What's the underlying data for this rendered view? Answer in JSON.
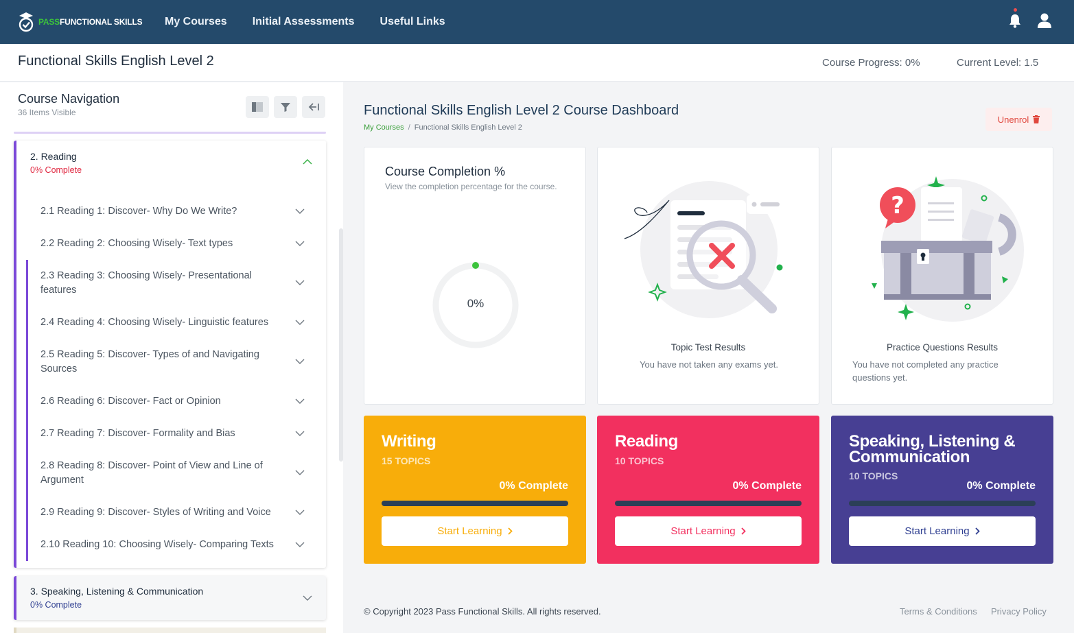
{
  "brand": {
    "pass": "PASS",
    "rest": "FUNCTIONAL SKILLS"
  },
  "nav": {
    "links": [
      "My Courses",
      "Initial Assessments",
      "Useful Links"
    ]
  },
  "course": {
    "title": "Functional Skills English Level 2",
    "progress_label": "Course Progress:",
    "progress_value": "0%",
    "level_label": "Current Level:",
    "level_value": "1.5"
  },
  "sidebar": {
    "title": "Course Navigation",
    "subtitle": "36 Items Visible",
    "sections": [
      {
        "title": "2. Reading",
        "complete": "0% Complete",
        "items": [
          "2.1 Reading 1: Discover- Why Do We Write?",
          "2.2 Reading 2: Choosing Wisely- Text types",
          "2.3 Reading 3: Choosing Wisely- Presentational features",
          "2.4 Reading 4: Choosing Wisely- Linguistic features",
          "2.5 Reading 5: Discover- Types of and Navigating Sources",
          "2.6 Reading 6: Discover- Fact or Opinion",
          "2.7 Reading 7: Discover- Formality and Bias",
          "2.8 Reading 8: Discover- Point of View and Line of Argument",
          "2.9 Reading 9: Discover- Styles of Writing and Voice",
          "2.10 Reading 10: Choosing Wisely- Comparing Texts"
        ]
      },
      {
        "title": "3. Speaking, Listening & Communication",
        "complete": "0% Complete"
      }
    ]
  },
  "dashboard": {
    "title": "Functional Skills English Level 2 Course Dashboard",
    "breadcrumb": [
      "My Courses",
      "Functional Skills English Level 2"
    ],
    "unenrol": "Unenrol",
    "completion": {
      "title": "Course Completion %",
      "subtitle": "View the completion percentage for the course.",
      "value": "0%",
      "fraction": 0
    },
    "topic_tests": {
      "label": "Topic Test Results",
      "text": "You have not taken any exams yet."
    },
    "practice": {
      "label": "Practice Questions Results",
      "text": "You have not completed any practice questions yet."
    },
    "subjects": [
      {
        "name": "Writing",
        "topics": "15 TOPICS",
        "complete": "0% Complete",
        "progress": 0,
        "button": "Start Learning",
        "color": "#f8ad0a"
      },
      {
        "name": "Reading",
        "topics": "10 TOPICS",
        "complete": "0% Complete",
        "progress": 0,
        "button": "Start Learning",
        "color": "#f2305f"
      },
      {
        "name": "Speaking, Listening & Communication",
        "topics": "10 TOPICS",
        "complete": "0% Complete",
        "progress": 0,
        "button": "Start Learning",
        "color": "#473f93"
      }
    ]
  },
  "footer": {
    "copyright": "© Copyright 2023 Pass Functional Skills. All rights reserved.",
    "links": [
      "Terms & Conditions",
      "Privacy Policy"
    ]
  },
  "colors": {
    "nav_bg": "#244a6b",
    "accent_purple": "#7b49d8",
    "green": "#3cc33c",
    "red": "#e0473d"
  }
}
